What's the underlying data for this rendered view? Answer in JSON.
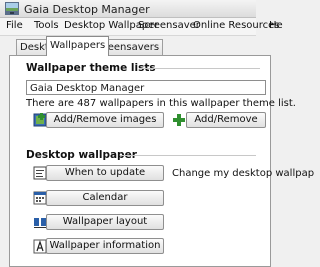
{
  "window": {
    "title": "Gaia Desktop Manager"
  },
  "menu": [
    "File",
    "Tools",
    "Desktop Wallpaper",
    "Screensaver",
    "Online Resources",
    "He"
  ],
  "tabs": [
    "Desktop",
    "Wallpapers",
    "Screensavers"
  ],
  "active_tab": "Wallpapers",
  "theme_lists": {
    "title": "Wallpaper theme lists",
    "selected_list": "Gaia Desktop Manager",
    "info_text": "There are 487 wallpapers in this wallpaper theme list.",
    "add_remove_images_label": "Add/Remove images",
    "add_remove_label": "Add/Remove"
  },
  "desktop_wallpaper": {
    "title": "Desktop wallpaper",
    "when_to_update_label": "When to update",
    "change_text": "Change my desktop wallpap",
    "calendar_label": "Calendar",
    "layout_label": "Wallpaper layout",
    "information_label": "Wallpaper information"
  },
  "colors": {
    "accent": "#2f8f2f",
    "icon_blue": "#2a5fa8"
  }
}
